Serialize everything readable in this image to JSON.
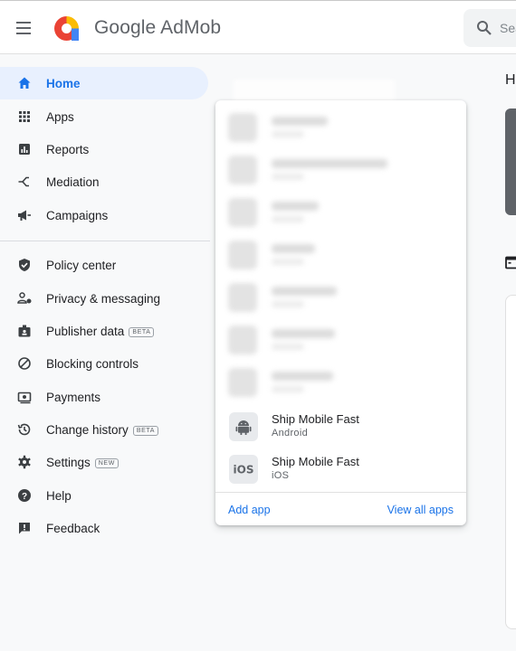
{
  "header": {
    "brand_google": "Google",
    "brand_product": "AdMob",
    "search_placeholder": "Sea"
  },
  "sidebar": {
    "items": [
      {
        "label": "Home",
        "icon": "home-icon",
        "active": true
      },
      {
        "label": "Apps",
        "icon": "apps-grid-icon"
      },
      {
        "label": "Reports",
        "icon": "bar-chart-icon"
      },
      {
        "label": "Mediation",
        "icon": "mediation-icon"
      },
      {
        "label": "Campaigns",
        "icon": "megaphone-icon"
      },
      {
        "label": "Policy center",
        "icon": "shield-check-icon"
      },
      {
        "label": "Privacy & messaging",
        "icon": "person-privacy-icon"
      },
      {
        "label": "Publisher data",
        "icon": "id-badge-icon",
        "badge": "BETA"
      },
      {
        "label": "Blocking controls",
        "icon": "block-icon"
      },
      {
        "label": "Payments",
        "icon": "payments-icon"
      },
      {
        "label": "Change history",
        "icon": "history-icon",
        "badge": "BETA"
      },
      {
        "label": "Settings",
        "icon": "gear-icon",
        "badge": "NEW"
      },
      {
        "label": "Help",
        "icon": "help-icon"
      },
      {
        "label": "Feedback",
        "icon": "feedback-icon"
      }
    ]
  },
  "main": {
    "title_partial": "H"
  },
  "apps_panel": {
    "apps": [
      {
        "name": "Ship Mobile Fast",
        "platform": "Android",
        "icon": "android-icon"
      },
      {
        "name": "Ship Mobile Fast",
        "platform": "iOS",
        "icon": "ios-icon",
        "icon_text": "iOS"
      }
    ],
    "add_app": "Add app",
    "view_all": "View all apps"
  },
  "colors": {
    "accent": "#1a73e8",
    "active_bg": "#e8f0fe",
    "icon": "#202124",
    "logo_red": "#ea4335",
    "logo_yellow": "#fbbc04",
    "logo_blue": "#4285f4"
  }
}
